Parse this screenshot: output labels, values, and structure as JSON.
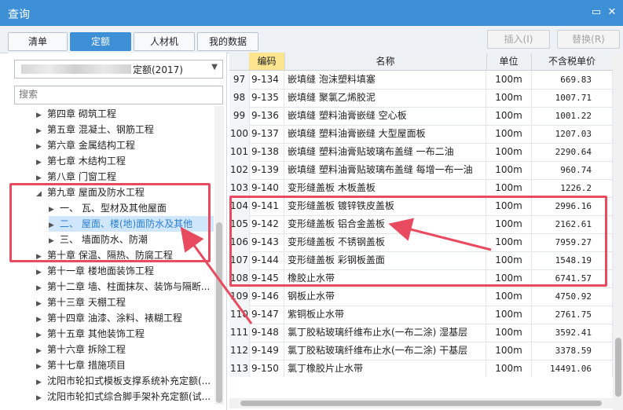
{
  "window": {
    "title": "查询",
    "minimize_glyph": "▭",
    "close_glyph": "✕"
  },
  "tabs": [
    {
      "label": "清单",
      "active": false
    },
    {
      "label": "定额",
      "active": true
    },
    {
      "label": "人材机",
      "active": false
    },
    {
      "label": "我的数据",
      "active": false
    }
  ],
  "actions": {
    "insert_label": "插入(I)",
    "replace_label": "替换(R)"
  },
  "library": {
    "selected_suffix": "定额(2017)"
  },
  "search": {
    "placeholder": "搜索",
    "value": ""
  },
  "tree": [
    {
      "label": "第四章 砌筑工程",
      "level": 0,
      "expanded": false,
      "selected": false
    },
    {
      "label": "第五章 混凝土、钢筋工程",
      "level": 0,
      "expanded": false,
      "selected": false
    },
    {
      "label": "第六章 金属结构工程",
      "level": 0,
      "expanded": false,
      "selected": false
    },
    {
      "label": "第七章 木结构工程",
      "level": 0,
      "expanded": false,
      "selected": false
    },
    {
      "label": "第八章 门窗工程",
      "level": 0,
      "expanded": false,
      "selected": false
    },
    {
      "label": "第九章 屋面及防水工程",
      "level": 0,
      "expanded": true,
      "selected": false
    },
    {
      "label": "一、 瓦、型材及其他屋面",
      "level": 1,
      "expanded": false,
      "selected": false
    },
    {
      "label": "二、 屋面、楼(地)面防水及其他",
      "level": 1,
      "expanded": false,
      "selected": true
    },
    {
      "label": "三、 墙面防水、防潮",
      "level": 1,
      "expanded": false,
      "selected": false
    },
    {
      "label": "第十章 保温、隔热、防腐工程",
      "level": 0,
      "expanded": false,
      "selected": false
    },
    {
      "label": "第十一章 楼地面装饰工程",
      "level": 0,
      "expanded": false,
      "selected": false
    },
    {
      "label": "第十二章 墙、柱面抹灰、装饰与隔断...",
      "level": 0,
      "expanded": false,
      "selected": false
    },
    {
      "label": "第十三章 天棚工程",
      "level": 0,
      "expanded": false,
      "selected": false
    },
    {
      "label": "第十四章 油漆、涂料、裱糊工程",
      "level": 0,
      "expanded": false,
      "selected": false
    },
    {
      "label": "第十五章 其他装饰工程",
      "level": 0,
      "expanded": false,
      "selected": false
    },
    {
      "label": "第十六章 拆除工程",
      "level": 0,
      "expanded": false,
      "selected": false
    },
    {
      "label": "第十七章 措施项目",
      "level": 0,
      "expanded": false,
      "selected": false
    },
    {
      "label": "沈阳市轮扣式模板支撑系统补充定额(...",
      "level": 0,
      "expanded": false,
      "selected": false
    },
    {
      "label": "沈阳市轮扣式综合脚手架补充定额(试...",
      "level": 0,
      "expanded": false,
      "selected": false
    }
  ],
  "table": {
    "columns": {
      "code": "编码",
      "name": "名称",
      "unit": "单位",
      "price": "不含税单价"
    },
    "rows": [
      {
        "no": "97",
        "code": "9-134",
        "name": "嵌填缝 泡沫塑料填塞",
        "unit": "100m",
        "price": "669.83"
      },
      {
        "no": "98",
        "code": "9-135",
        "name": "嵌填缝 聚氯乙烯胶泥",
        "unit": "100m",
        "price": "1007.71"
      },
      {
        "no": "99",
        "code": "9-136",
        "name": "嵌填缝 塑料油膏嵌缝 空心板",
        "unit": "100m",
        "price": "1001.22"
      },
      {
        "no": "100",
        "code": "9-137",
        "name": "嵌填缝 塑料油膏嵌缝 大型屋面板",
        "unit": "100m",
        "price": "1207.03"
      },
      {
        "no": "101",
        "code": "9-138",
        "name": "嵌填缝 塑料油膏贴玻璃布盖缝 一布二油",
        "unit": "100m",
        "price": "2290.64"
      },
      {
        "no": "102",
        "code": "9-139",
        "name": "嵌填缝 塑料油膏贴玻璃布盖缝 每增一布一油",
        "unit": "100m",
        "price": "960.74"
      },
      {
        "no": "103",
        "code": "9-140",
        "name": "变形缝盖板 木板盖板",
        "unit": "100m",
        "price": "1226.2"
      },
      {
        "no": "104",
        "code": "9-141",
        "name": "变形缝盖板 镀锌铁皮盖板",
        "unit": "100m",
        "price": "2996.16"
      },
      {
        "no": "105",
        "code": "9-142",
        "name": "变形缝盖板 铝合金盖板",
        "unit": "100m",
        "price": "2162.61"
      },
      {
        "no": "106",
        "code": "9-143",
        "name": "变形缝盖板 不锈钢盖板",
        "unit": "100m",
        "price": "7959.27"
      },
      {
        "no": "107",
        "code": "9-144",
        "name": "变形缝盖板 彩钢板盖面",
        "unit": "100m",
        "price": "1548.19"
      },
      {
        "no": "108",
        "code": "9-145",
        "name": "橡胶止水带",
        "unit": "100m",
        "price": "6741.57"
      },
      {
        "no": "109",
        "code": "9-146",
        "name": "钢板止水带",
        "unit": "100m",
        "price": "4750.92"
      },
      {
        "no": "110",
        "code": "9-147",
        "name": "紫铜板止水带",
        "unit": "100m",
        "price": "2761.75"
      },
      {
        "no": "111",
        "code": "9-148",
        "name": "氯丁胶粘玻璃纤维布止水(一布二涂) 湿基层",
        "unit": "100m",
        "price": "3592.41"
      },
      {
        "no": "112",
        "code": "9-149",
        "name": "氯丁胶粘玻璃纤维布止水(一布二涂) 干基层",
        "unit": "100m",
        "price": "3378.59"
      },
      {
        "no": "113",
        "code": "9-150",
        "name": "氯丁橡胶片止水带",
        "unit": "100m",
        "price": "14491.06"
      }
    ]
  },
  "colors": {
    "accent": "#3d8fd6",
    "annotation": "#e84a5f",
    "code_header": "#fde58f",
    "selected_tree": "#cfe6fb"
  }
}
